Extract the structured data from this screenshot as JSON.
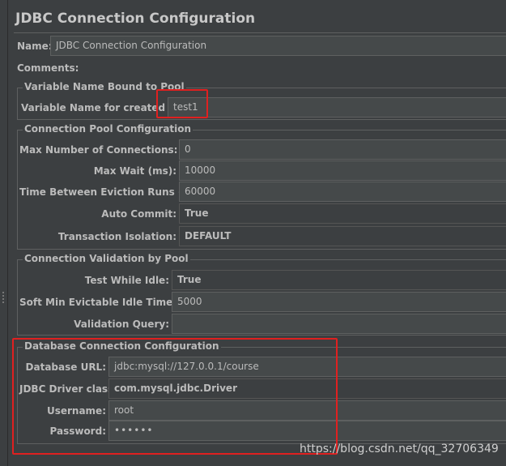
{
  "title": "JDBC Connection Configuration",
  "name": {
    "label": "Name:",
    "value": "JDBC Connection Configuration"
  },
  "comments": {
    "label": "Comments:"
  },
  "variable_group": {
    "title": "Variable Name Bound to Pool",
    "label": "Variable Name for created pool:",
    "value": "test1"
  },
  "pool_group": {
    "title": "Connection Pool Configuration",
    "max_connections": {
      "label": "Max Number of Connections:",
      "value": "0"
    },
    "max_wait": {
      "label": "Max Wait (ms):",
      "value": "10000"
    },
    "eviction": {
      "label": "Time Between Eviction Runs (ms):",
      "value": "60000"
    },
    "auto_commit": {
      "label": "Auto Commit:",
      "value": "True"
    },
    "isolation": {
      "label": "Transaction Isolation:",
      "value": "DEFAULT"
    }
  },
  "validation_group": {
    "title": "Connection Validation by Pool",
    "test_idle": {
      "label": "Test While Idle:",
      "value": "True"
    },
    "soft_min": {
      "label": "Soft Min Evictable Idle Time(ms):",
      "value": "5000"
    },
    "query": {
      "label": "Validation Query:",
      "value": ""
    }
  },
  "db_group": {
    "title": "Database Connection Configuration",
    "url": {
      "label": "Database URL:",
      "value": "jdbc:mysql://127.0.0.1/course"
    },
    "driver": {
      "label": "JDBC Driver class:",
      "value": "com.mysql.jdbc.Driver"
    },
    "username": {
      "label": "Username:",
      "value": "root"
    },
    "password": {
      "label": "Password:",
      "value": "••••••"
    }
  },
  "watermark": "https://blog.csdn.net/qq_32706349",
  "colors": {
    "highlight": "#e02020",
    "background": "#3c3f41"
  }
}
